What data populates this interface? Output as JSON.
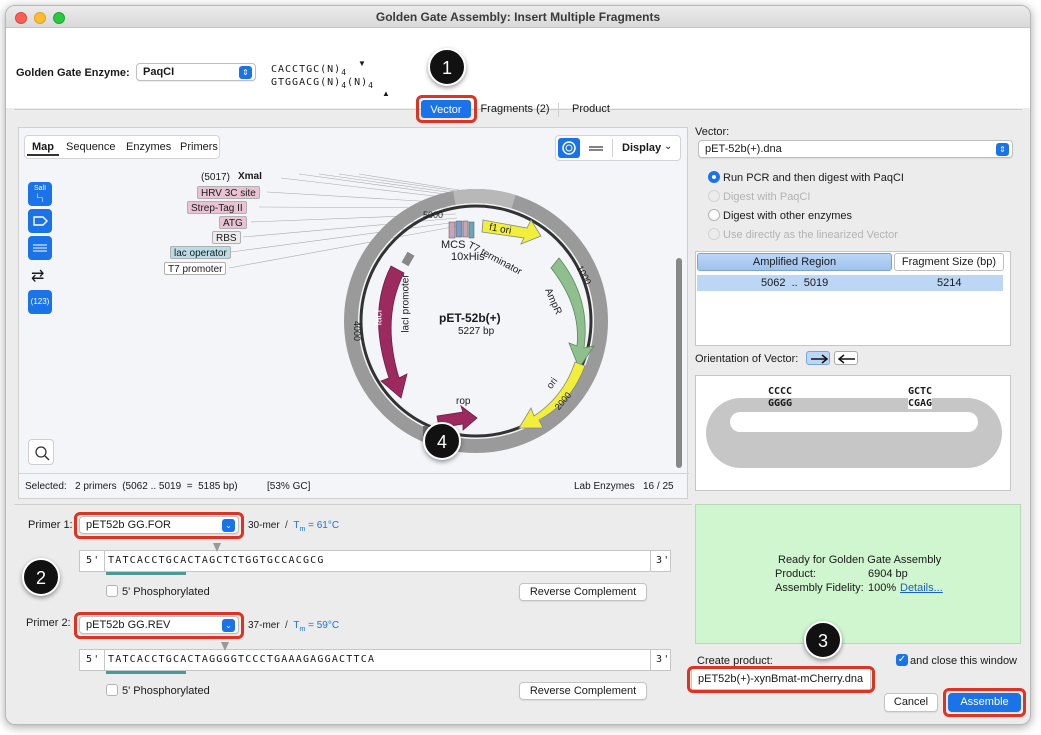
{
  "window": {
    "title": "Golden Gate Assembly: Insert Multiple Fragments"
  },
  "enzyme": {
    "label": "Golden Gate Enzyme:",
    "value": "PaqCI",
    "site_top": "CACCTGC(N)",
    "site_top_sub": "4",
    "site_bottom": "GTGGACG(N)",
    "site_bottom_sub": "4",
    "site_bottom_tail": "(N)",
    "site_bottom_tail_sub": "4"
  },
  "tabs": [
    {
      "label": "Vector",
      "selected": true
    },
    {
      "label": "Fragments (2)",
      "selected": false
    },
    {
      "label": "Product",
      "selected": false
    }
  ],
  "map_view": {
    "tabs": [
      "Map",
      "Sequence",
      "Enzymes",
      "Primers"
    ],
    "display_label": "Display",
    "plasmid_name": "pET-52b(+)",
    "plasmid_size": "5227 bp",
    "xmai_pos": "(5017)",
    "xmai_name": "XmaI",
    "feature_labels": [
      "HRV 3C site",
      "Strep-Tag II",
      "ATG",
      "RBS",
      "lac operator",
      "T7 promoter"
    ],
    "map_labels": {
      "mcs": "MCS",
      "his": "10xHis",
      "f1": "f1 ori",
      "t7term": "T7 terminator",
      "ampr": "AmpR",
      "ori": "ori",
      "laci": "lacI",
      "laci_promoter": "lacI promoter",
      "rop": "rop",
      "tick1000": "1000",
      "tick2000": "2000",
      "tick4000": "4000",
      "tick5000": "5000"
    },
    "side_tools": [
      "SalI",
      "",
      "",
      "",
      "(123)"
    ],
    "selected_label": "Selected:",
    "selected_value": "2 primers  (5062 .. 5019  =  5185 bp)",
    "gc": "[53% GC]",
    "lab_enzymes": "Lab Enzymes",
    "enzyme_count": "16 / 25"
  },
  "primer1": {
    "label": "Primer 1:",
    "name": "pET52b GG.FOR",
    "length": "30-mer",
    "tm_label": "T",
    "tm_sub": "m",
    "tm_value": "= 61°C",
    "five": "5'",
    "three": "3'",
    "sequence": "TATCACCTGCACTAGCTCTGGTGCCACGCG",
    "phos_label": "5' Phosphorylated",
    "rc_label": "Reverse Complement"
  },
  "primer2": {
    "label": "Primer 2:",
    "name": "pET52b GG.REV",
    "length": "37-mer",
    "tm_label": "T",
    "tm_sub": "m",
    "tm_value": "= 59°C",
    "five": "5'",
    "three": "3'",
    "sequence": "TATCACCTGCACTAGGGGTCCCTGAAAGAGGACTTCA",
    "phos_label": "5' Phosphorylated",
    "rc_label": "Reverse Complement"
  },
  "vector_panel": {
    "label": "Vector:",
    "file": "pET-52b(+).dna",
    "options": [
      {
        "label": "Run PCR and then digest with PaqCI",
        "selected": true,
        "enabled": true
      },
      {
        "label": "Digest with PaqCI",
        "selected": false,
        "enabled": false
      },
      {
        "label": "Digest with other enzymes",
        "selected": false,
        "enabled": true
      },
      {
        "label": "Use directly as the linearized Vector",
        "selected": false,
        "enabled": false
      }
    ],
    "col_region": "Amplified Region",
    "col_size": "Fragment Size (bp)",
    "row_region": "5062  ..  5019",
    "row_size": "5214",
    "orientation_label": "Orientation of Vector:",
    "overhang_left_top": "CCCC",
    "overhang_left_bottom": "GGGG",
    "overhang_right_top": "GCTC",
    "overhang_right_bottom": "CGAG"
  },
  "status": {
    "ready": "Ready for Golden Gate Assembly",
    "product_label": "Product:",
    "product_value": "6904 bp",
    "fidelity_label": "Assembly Fidelity:",
    "fidelity_value": "100%",
    "details_link": "Details..."
  },
  "create": {
    "label": "Create product:",
    "filename": "pET52b(+)-xynBmat-mCherry.dna",
    "close_label": "and close this window",
    "close_checked": true
  },
  "buttons": {
    "cancel": "Cancel",
    "assemble": "Assemble"
  },
  "callouts": [
    "1",
    "2",
    "3",
    "4"
  ],
  "colors": {
    "accent": "#1a73e8",
    "callout_red": "#e0331f",
    "laci": "#9c2a5e",
    "ampr": "#8fbf8f",
    "f1_ori": "#f2ee3c",
    "ori": "#f2ee3c",
    "ready_bg": "#cff6cf"
  }
}
